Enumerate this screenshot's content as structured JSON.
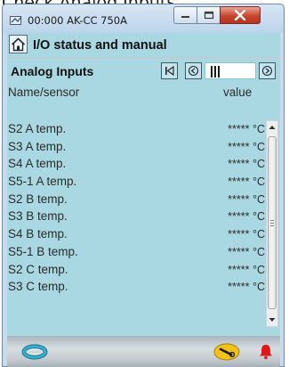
{
  "caption": "Check Analog Inputs",
  "window": {
    "title": "00:000 AK-CC 750A",
    "icon": "app-icon",
    "controls": {
      "minimize_icon": "minimize-icon",
      "maximize_icon": "maximize-icon",
      "close_icon": "close-icon",
      "close_color": "#c7462e"
    }
  },
  "header": {
    "home_icon": "home-icon",
    "title": "I/O status and manual"
  },
  "section": {
    "title": "Analog Inputs",
    "nav": {
      "first_icon": "first-page-icon",
      "prev_icon": "prev-page-icon",
      "next_icon": "next-page-icon",
      "page_position": 0.08
    }
  },
  "columns": {
    "name": "Name/sensor",
    "value": "value"
  },
  "rows": [
    {
      "name": "S2 A temp.",
      "value": "***** °C"
    },
    {
      "name": "S3 A temp.",
      "value": "***** °C"
    },
    {
      "name": "S4 A temp.",
      "value": "***** °C"
    },
    {
      "name": "S5-1 A temp.",
      "value": "***** °C"
    },
    {
      "name": "S2 B temp.",
      "value": "***** °C"
    },
    {
      "name": "S3 B temp.",
      "value": "***** °C"
    },
    {
      "name": "S4 B temp.",
      "value": "***** °C"
    },
    {
      "name": "S5-1 B temp.",
      "value": "***** °C"
    },
    {
      "name": "S2 C temp.",
      "value": "***** °C"
    },
    {
      "name": "S3 C temp.",
      "value": "***** °C"
    }
  ],
  "bottombar": {
    "keyboard_icon": "keyboard-icon",
    "tool_icon": "wrench-icon",
    "alarm_icon": "alarm-bell-icon",
    "alarm_color": "#e01818"
  },
  "colors": {
    "panel": "#aad8e2",
    "window_frame": "#c6dcee"
  }
}
